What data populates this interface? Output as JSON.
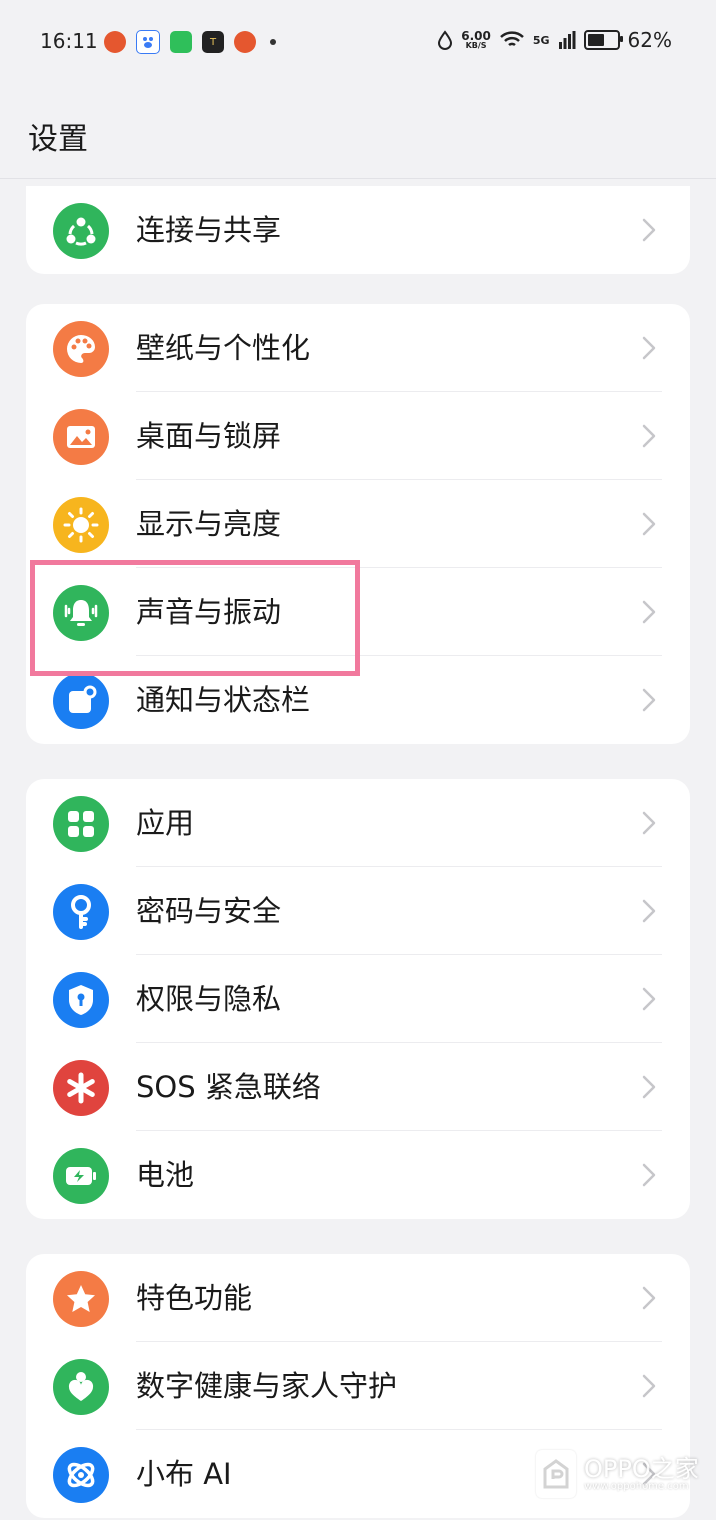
{
  "status_bar": {
    "time": "16:11",
    "net_speed_value": "6.00",
    "net_speed_unit": "KB/S",
    "network_type": "5G",
    "battery_percent": "62%",
    "battery_level": 0.62
  },
  "page": {
    "title": "设置"
  },
  "groups": [
    {
      "items": [
        {
          "label": "连接与共享",
          "icon": "share-icon",
          "color": "#30b55c"
        }
      ]
    },
    {
      "items": [
        {
          "label": "壁纸与个性化",
          "icon": "palette-icon",
          "color": "#f47b45"
        },
        {
          "label": "桌面与锁屏",
          "icon": "picture-icon",
          "color": "#f47b45"
        },
        {
          "label": "显示与亮度",
          "icon": "sun-icon",
          "color": "#f7b51e"
        },
        {
          "label": "声音与振动",
          "icon": "bell-vibrate-icon",
          "color": "#30b55c"
        },
        {
          "label": "通知与状态栏",
          "icon": "notification-icon",
          "color": "#1a7ef2"
        }
      ]
    },
    {
      "items": [
        {
          "label": "应用",
          "icon": "apps-grid-icon",
          "color": "#30b55c"
        },
        {
          "label": "密码与安全",
          "icon": "key-icon",
          "color": "#1a7ef2"
        },
        {
          "label": "权限与隐私",
          "icon": "shield-icon",
          "color": "#1a7ef2"
        },
        {
          "label": "SOS 紧急联络",
          "icon": "sos-asterisk-icon",
          "color": "#e0443e"
        },
        {
          "label": "电池",
          "icon": "battery-icon",
          "color": "#30b55c"
        }
      ]
    },
    {
      "items": [
        {
          "label": "特色功能",
          "icon": "star-icon",
          "color": "#f47b45"
        },
        {
          "label": "数字健康与家人守护",
          "icon": "heart-person-icon",
          "color": "#30b55c"
        },
        {
          "label": "小布 AI",
          "icon": "ai-assistant-icon",
          "color": "#1a7ef2"
        }
      ]
    }
  ],
  "watermark": {
    "text": "OPPO之家",
    "url": "www.oppohome.com"
  }
}
